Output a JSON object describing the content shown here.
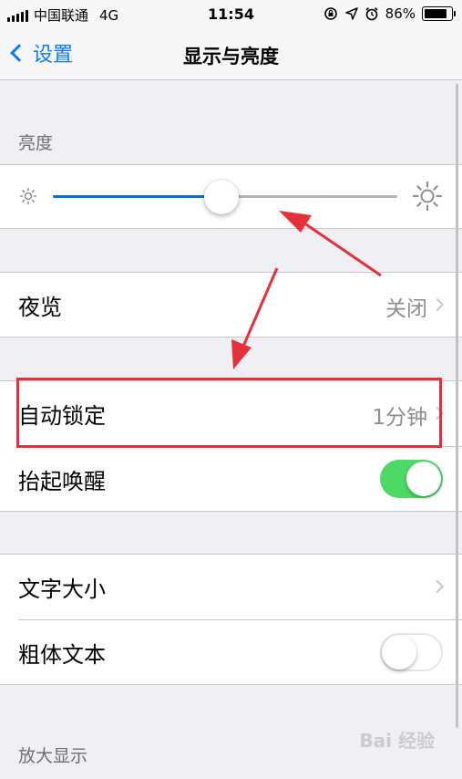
{
  "status_bar": {
    "carrier": "中国联通",
    "network": "4G",
    "time": "11:54",
    "battery": "86%",
    "battery_level": 0.86
  },
  "nav": {
    "back_label": "设置",
    "title": "显示与亮度"
  },
  "brightness": {
    "header": "亮度",
    "level": 0.49
  },
  "night_shift": {
    "label": "夜览",
    "value": "关闭"
  },
  "auto_lock": {
    "label": "自动锁定",
    "value": "1分钟"
  },
  "raise_to_wake": {
    "label": "抬起唤醒",
    "enabled": true
  },
  "text_size": {
    "label": "文字大小"
  },
  "bold_text": {
    "label": "粗体文本",
    "enabled": false
  },
  "zoom": {
    "header": "放大显示"
  },
  "watermark": "Bai 经验",
  "colors": {
    "accent": "#0a7aff",
    "toggle_on": "#4cd964",
    "annotation": "#e5303a"
  }
}
